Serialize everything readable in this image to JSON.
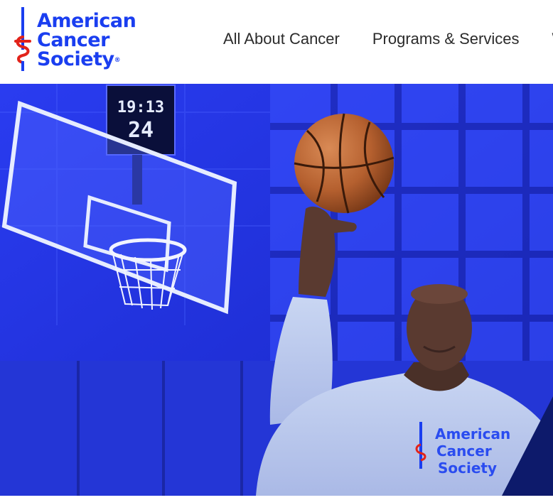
{
  "brand": {
    "name_lines": [
      "American",
      "Cancer",
      "Society"
    ],
    "registered_mark": "®",
    "color": "#1a3ef0",
    "accent": "#e2231a"
  },
  "nav": {
    "items": [
      {
        "label": "All About Cancer"
      },
      {
        "label": "Programs & Services"
      },
      {
        "label": "W"
      }
    ]
  },
  "hero": {
    "scoreboard": {
      "clock": "19:13",
      "shot_clock": "24"
    },
    "shirt_logo_lines": [
      "American",
      "Cancer",
      "Society"
    ],
    "tint": "#1f2fd8"
  }
}
